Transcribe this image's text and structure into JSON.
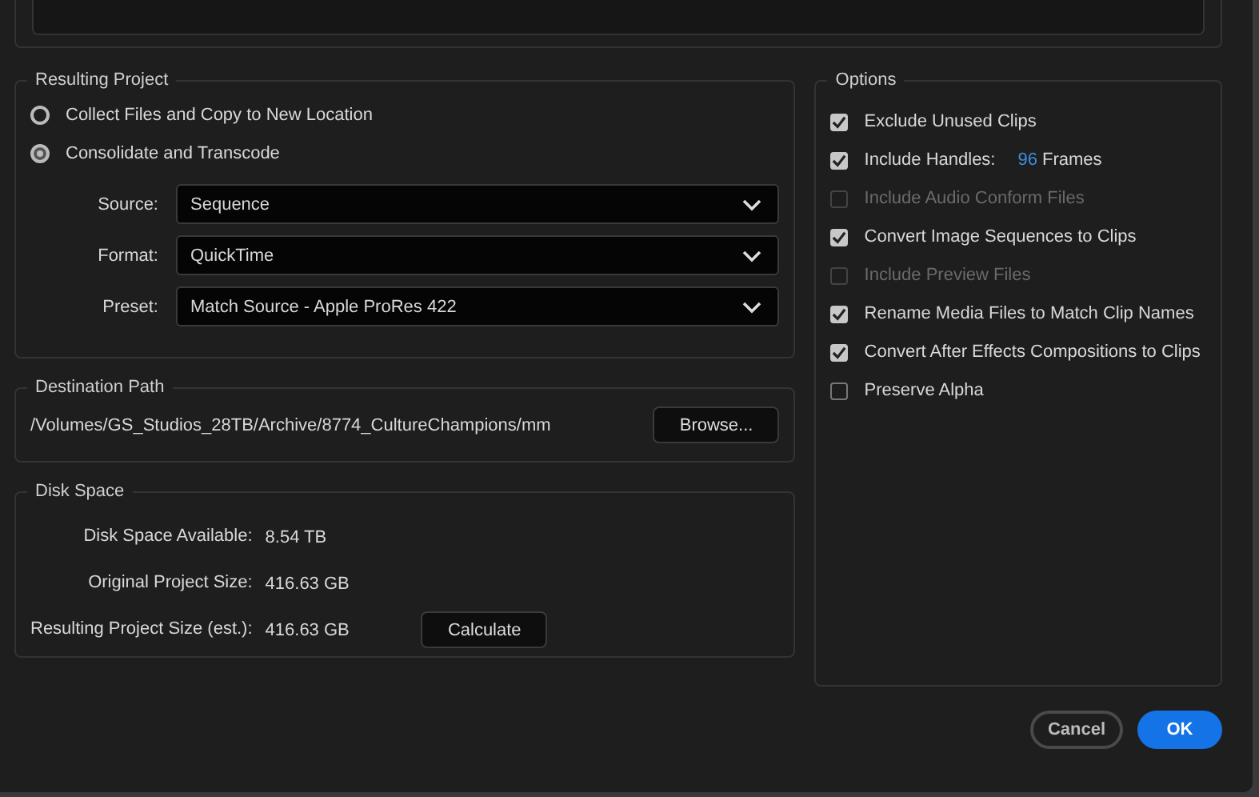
{
  "resulting_project": {
    "title": "Resulting Project",
    "modes": [
      {
        "label": "Collect Files and Copy to New Location",
        "selected": false
      },
      {
        "label": "Consolidate and Transcode",
        "selected": true
      }
    ],
    "fields": [
      {
        "label": "Source:",
        "value": "Sequence"
      },
      {
        "label": "Format:",
        "value": "QuickTime"
      },
      {
        "label": "Preset:",
        "value": "Match Source - Apple ProRes 422"
      }
    ]
  },
  "destination": {
    "title": "Destination Path",
    "path": "/Volumes/GS_Studios_28TB/Archive/8774_CultureChampions/mm",
    "button": "Browse..."
  },
  "disk_space": {
    "title": "Disk Space",
    "rows": [
      {
        "label": "Disk Space Available:",
        "value": "8.54 TB"
      },
      {
        "label": "Original Project Size:",
        "value": "416.63 GB"
      },
      {
        "label": "Resulting Project Size (est.):",
        "value": "416.63 GB"
      }
    ],
    "button": "Calculate"
  },
  "options": {
    "title": "Options",
    "items": [
      {
        "label": "Exclude Unused Clips",
        "checked": true,
        "disabled": false
      },
      {
        "label": "Include Handles:",
        "checked": true,
        "disabled": false,
        "value": "96",
        "unit": "Frames"
      },
      {
        "label": "Include Audio Conform Files",
        "checked": false,
        "disabled": true
      },
      {
        "label": "Convert Image Sequences to Clips",
        "checked": true,
        "disabled": false
      },
      {
        "label": "Include Preview Files",
        "checked": false,
        "disabled": true
      },
      {
        "label": "Rename Media Files to Match Clip Names",
        "checked": true,
        "disabled": false
      },
      {
        "label": "Convert After Effects Compositions to Clips",
        "checked": true,
        "disabled": false
      },
      {
        "label": "Preserve Alpha",
        "checked": false,
        "disabled": false
      }
    ]
  },
  "buttons": [
    {
      "label": "Cancel",
      "kind": "secondary"
    },
    {
      "label": "OK",
      "kind": "primary"
    }
  ]
}
